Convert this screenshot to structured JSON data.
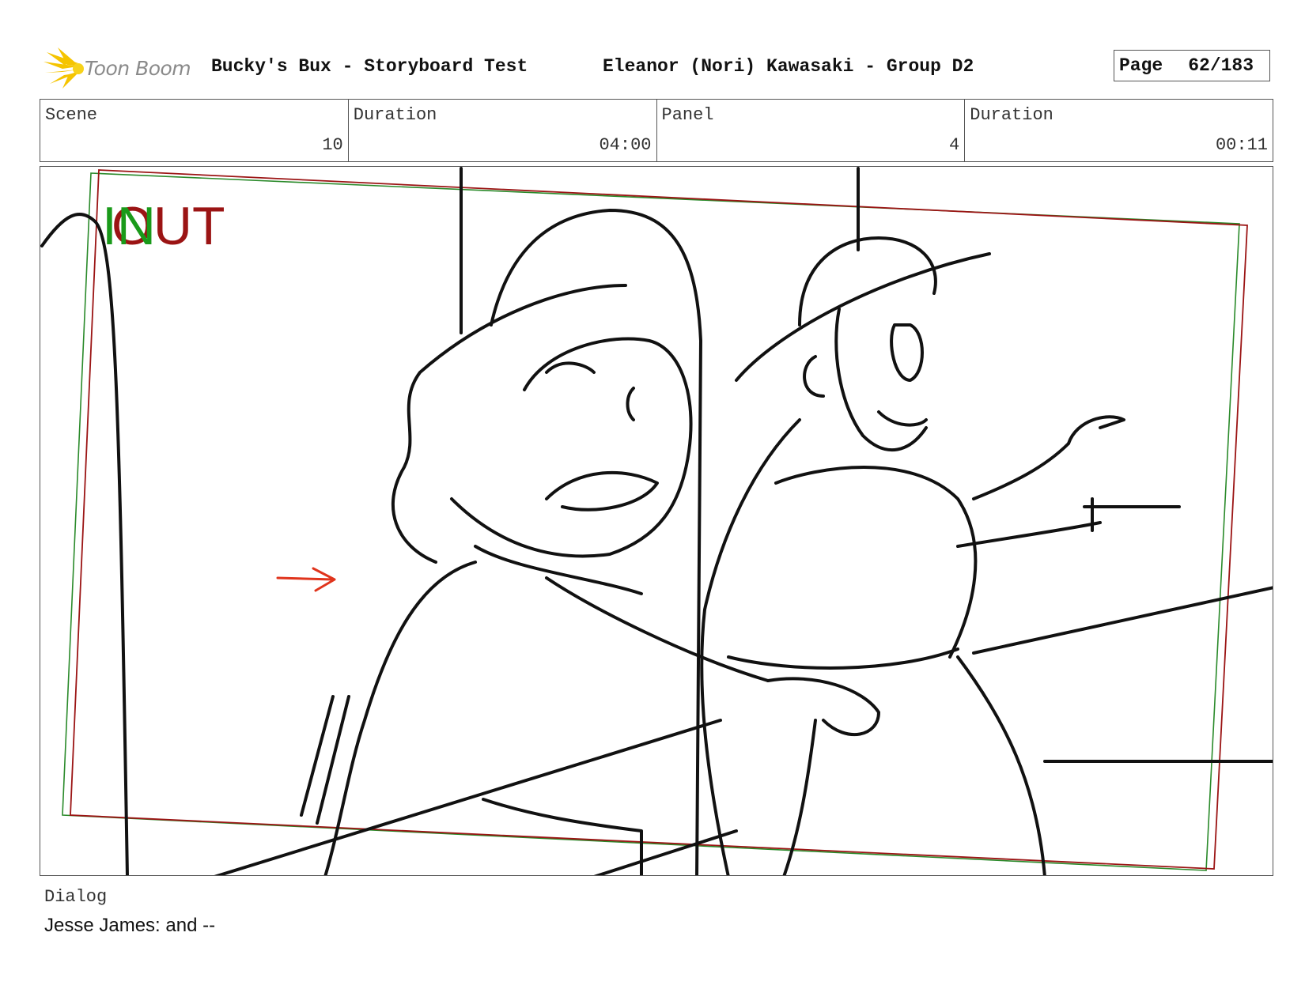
{
  "header": {
    "logo_text": "Toon Boom",
    "title": "Bucky's Bux - Storyboard Test",
    "author": "Eleanor (Nori) Kawasaki - Group D2",
    "page_label": "Page",
    "page_value": "62/183"
  },
  "info": {
    "scene_label": "Scene",
    "scene_value": "10",
    "scene_duration_label": "Duration",
    "scene_duration_value": "04:00",
    "panel_label": "Panel",
    "panel_value": "4",
    "panel_duration_label": "Duration",
    "panel_duration_value": "00:11"
  },
  "panel": {
    "in_marker": "IN",
    "out_marker": "OUT",
    "in_color": "#1a9a1a",
    "out_color": "#9b1414",
    "arrow_color": "#e0341c"
  },
  "dialog": {
    "label": "Dialog",
    "text": "Jesse James: and --"
  }
}
